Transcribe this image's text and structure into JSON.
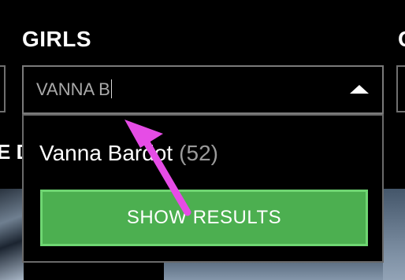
{
  "filter": {
    "section_title": "GIRLS",
    "next_section_title": "C",
    "left_section_heading": "E D"
  },
  "search": {
    "value": "VANNA B",
    "expanded": true
  },
  "dropdown": {
    "suggestions": [
      {
        "name": "Vanna Bardot",
        "count": "(52)"
      }
    ],
    "show_results_label": "SHOW RESULTS"
  },
  "colors": {
    "background": "#000000",
    "button": "#4caf50",
    "button_border": "#6fd672",
    "annotation_arrow": "#e64ce6"
  },
  "icons": {
    "dropdown_toggle": "chevron-up-icon",
    "annotation": "pointer-arrow"
  }
}
